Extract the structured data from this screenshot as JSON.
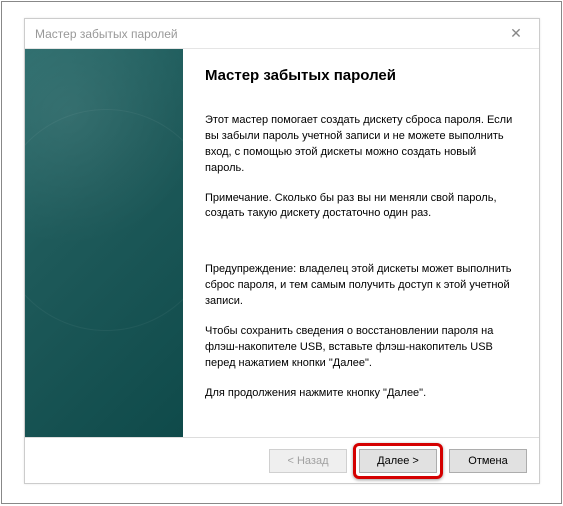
{
  "titlebar": {
    "text": "Мастер забытых паролей"
  },
  "main": {
    "heading": "Мастер забытых паролей",
    "p1": "Этот мастер помогает создать дискету сброса пароля. Если вы забыли пароль учетной записи и не можете выполнить вход, с помощью этой дискеты можно создать новый пароль.",
    "p2": "Примечание. Сколько бы раз вы ни меняли свой пароль, создать такую дискету достаточно один раз.",
    "p3": "Предупреждение: владелец этой дискеты может выполнить сброс пароля, и тем самым получить доступ к этой учетной записи.",
    "p4": "Чтобы сохранить сведения о восстановлении пароля на флэш-накопителе USB, вставьте флэш-накопитель USB перед нажатием кнопки \"Далее\".",
    "p5": "Для продолжения нажмите кнопку \"Далее\"."
  },
  "footer": {
    "back": "< Назад",
    "next": "Далее >",
    "cancel": "Отмена"
  }
}
